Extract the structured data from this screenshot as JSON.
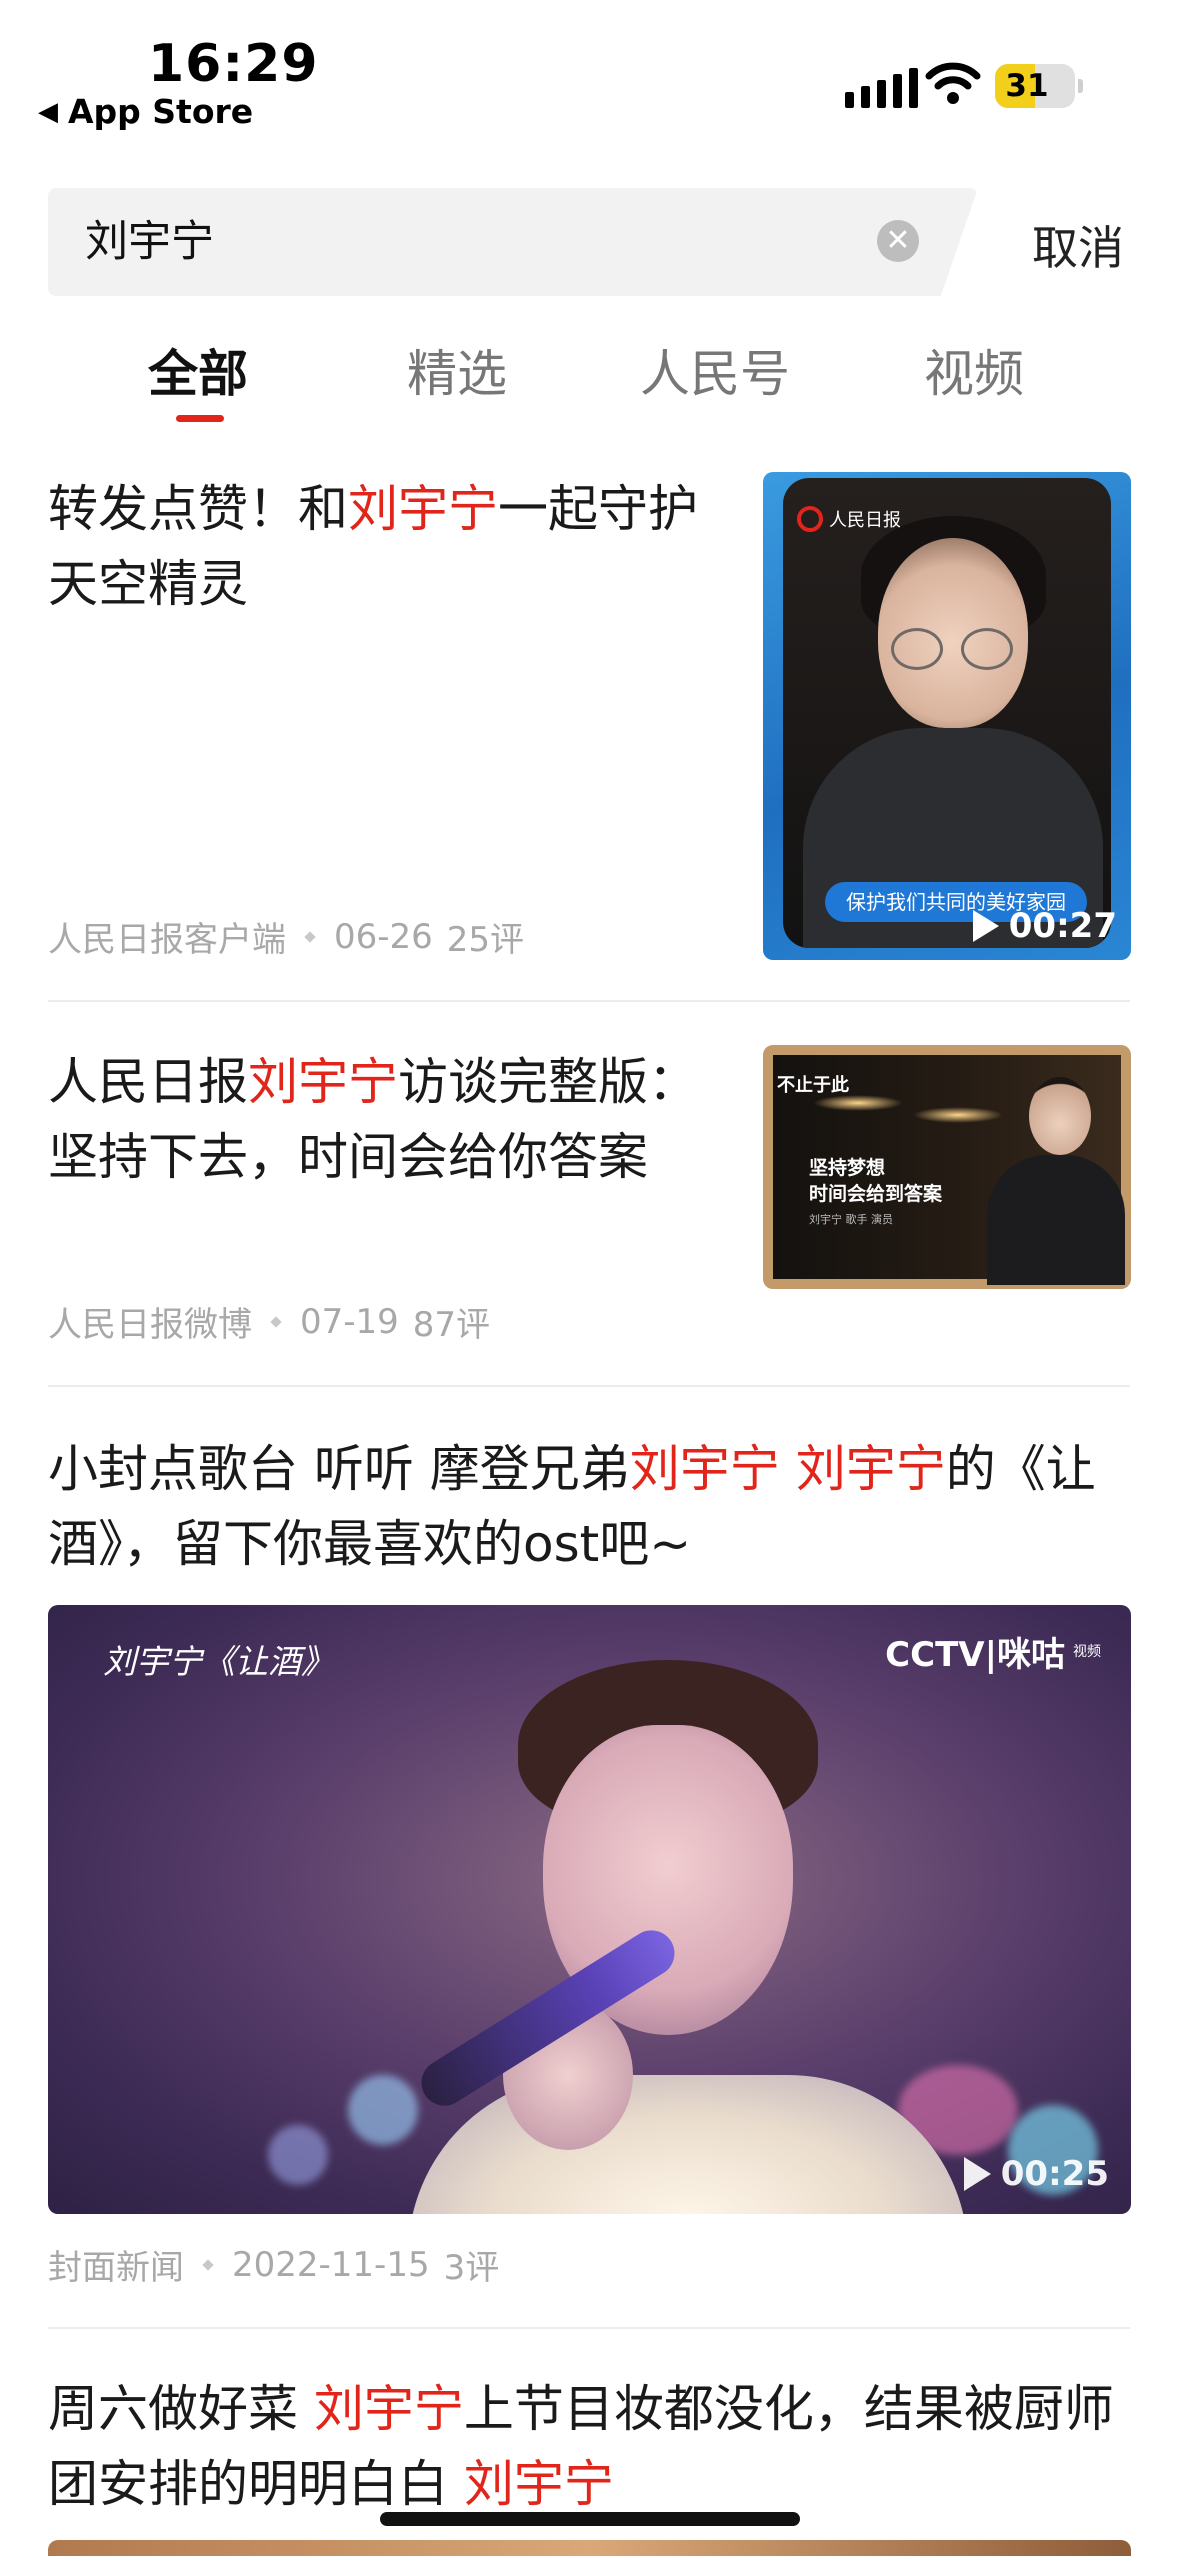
{
  "status_bar": {
    "time": "16:29",
    "back_label": "App Store",
    "battery_level": "31"
  },
  "search": {
    "query": "刘宇宁",
    "cancel_label": "取消"
  },
  "tabs": [
    {
      "label": "全部",
      "active": true
    },
    {
      "label": "精选",
      "active": false
    },
    {
      "label": "人民号",
      "active": false
    },
    {
      "label": "视频",
      "active": false
    }
  ],
  "articles": [
    {
      "title_parts": [
        "转发点赞！和",
        "刘宇宁",
        "一起守护天空精灵"
      ],
      "source": "人民日报客户端",
      "date": "06-26",
      "comments": "25评",
      "thumb": {
        "caption": "保护我们共同的美好家园",
        "duration": "00:27",
        "logo": "人民日报"
      }
    },
    {
      "title_parts": [
        "人民日报",
        "刘宇宁",
        "访谈完整版：坚持下去，时间会给你答案"
      ],
      "source": "人民日报微博",
      "date": "07-19",
      "comments": "87评",
      "thumb": {
        "logo": "不止于此",
        "text_line1": "坚持梦想",
        "text_line2": "时间会给到答案",
        "text_sub": "刘宇宁 歌手 演员"
      }
    },
    {
      "title_parts": [
        "小封点歌台 听听 摩登兄弟",
        "刘宇宁",
        " ",
        "刘宇宁",
        "的《让酒》，留下你最喜欢的ost吧~"
      ],
      "source": "封面新闻",
      "date": "2022-11-15",
      "comments": "3评",
      "video": {
        "label": "刘宇宁《让酒》",
        "brand": "CCTV|咪咕",
        "brand_small": "视频",
        "duration": "00:25"
      }
    },
    {
      "title_parts": [
        "周六做好菜 ",
        "刘宇宁",
        "上节目妆都没化，结果被厨师团安排的明明白白 ",
        "刘宇宁"
      ]
    }
  ],
  "colors": {
    "highlight": "#e1251b",
    "meta_text": "#a8a8a8",
    "divider": "#ececec"
  }
}
